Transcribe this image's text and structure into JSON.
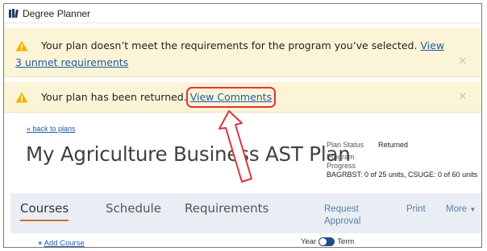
{
  "window": {
    "title": "Degree Planner",
    "logo_icon": "degree-planner-logo-icon"
  },
  "alerts": [
    {
      "icon": "warning-icon",
      "message": "Your plan doesn’t meet the requirements for the program you’ve selected. ",
      "link": "View 3 unmet requirements",
      "close_icon": "close-icon"
    },
    {
      "icon": "warning-icon",
      "message": "Your plan has been returned. ",
      "link": "View Comments",
      "close_icon": "close-icon"
    }
  ],
  "plan": {
    "back_link": "« back to plans",
    "title": "My Agriculture Business AST Plan",
    "status_label": "Plan Status",
    "status_value": "Returned",
    "progress_label_1": "Program",
    "progress_label_2": "Progress",
    "progress_value": "BAGRBST: 0 of 25 units, CSUGE: 0 of 60 units"
  },
  "tabs": [
    {
      "label": "Courses",
      "active": true
    },
    {
      "label": "Schedule",
      "active": false
    },
    {
      "label": "Requirements",
      "active": false
    }
  ],
  "actions": {
    "request_line1": "Request",
    "request_line2": "Approval",
    "print": "Print",
    "more": "More",
    "more_icon": "caret-down-icon"
  },
  "bottom": {
    "add_course": "Add Course",
    "toggle_left": "Year",
    "toggle_right": "Term"
  },
  "colors": {
    "alert_bg": "#fcf4d6",
    "link": "#1f5aa6",
    "annotation": "#e0323c",
    "tab_underline": "#d06a2a",
    "tabs_bg": "#e9eef5"
  }
}
